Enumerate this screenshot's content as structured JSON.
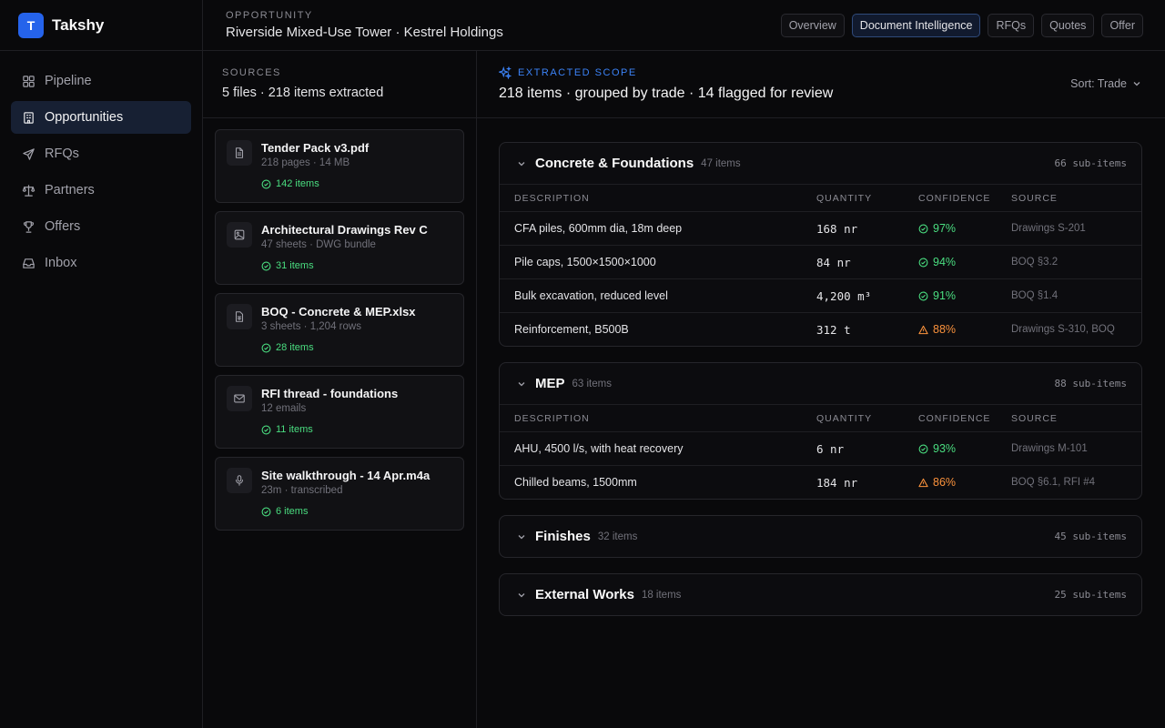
{
  "brand": {
    "logo_letter": "T",
    "name": "Takshy"
  },
  "nav": [
    {
      "label": "Pipeline",
      "icon": "grid-icon",
      "active": false
    },
    {
      "label": "Opportunities",
      "icon": "building-icon",
      "active": true
    },
    {
      "label": "RFQs",
      "icon": "send-icon",
      "active": false
    },
    {
      "label": "Partners",
      "icon": "scale-icon",
      "active": false
    },
    {
      "label": "Offers",
      "icon": "trophy-icon",
      "active": false
    },
    {
      "label": "Inbox",
      "icon": "inbox-icon",
      "active": false
    }
  ],
  "header": {
    "label": "OPPORTUNITY",
    "title": "Riverside Mixed-Use Tower · Kestrel Holdings",
    "tabs": [
      {
        "label": "Overview",
        "active": false
      },
      {
        "label": "Document Intelligence",
        "active": true
      },
      {
        "label": "RFQs",
        "active": false
      },
      {
        "label": "Quotes",
        "active": false
      },
      {
        "label": "Offer",
        "active": false
      }
    ]
  },
  "sources": {
    "label": "SOURCES",
    "summary": "5 files · 218 items extracted",
    "files": [
      {
        "name": "Tender Pack v3.pdf",
        "meta": "218 pages · 14 MB",
        "count": "142 items",
        "icon": "document-icon"
      },
      {
        "name": "Architectural Drawings Rev C",
        "meta": "47 sheets · DWG bundle",
        "count": "31 items",
        "icon": "image-icon"
      },
      {
        "name": "BOQ - Concrete & MEP.xlsx",
        "meta": "3 sheets · 1,204 rows",
        "count": "28 items",
        "icon": "spreadsheet-icon"
      },
      {
        "name": "RFI thread - foundations",
        "meta": "12 emails",
        "count": "11 items",
        "icon": "mail-icon"
      },
      {
        "name": "Site walkthrough - 14 Apr.m4a",
        "meta": "23m · transcribed",
        "count": "6 items",
        "icon": "microphone-icon"
      }
    ]
  },
  "main": {
    "label": "EXTRACTED SCOPE",
    "summary": "218 items · grouped by trade · 14 flagged for review",
    "sort_label": "Sort: Trade",
    "columns": [
      "DESCRIPTION",
      "QUANTITY",
      "CONFIDENCE",
      "SOURCE"
    ],
    "groups": [
      {
        "name": "Concrete & Foundations",
        "count": "47 items",
        "sub": "66 sub-items",
        "expanded": true,
        "rows": [
          {
            "description": "CFA piles, 600mm dia, 18m deep",
            "quantity": "168 nr",
            "confidence": "97%",
            "status": "ok",
            "source": "Drawings S-201"
          },
          {
            "description": "Pile caps, 1500×1500×1000",
            "quantity": "84 nr",
            "confidence": "94%",
            "status": "ok",
            "source": "BOQ §3.2"
          },
          {
            "description": "Bulk excavation, reduced level",
            "quantity": "4,200 m³",
            "confidence": "91%",
            "status": "ok",
            "source": "BOQ §1.4"
          },
          {
            "description": "Reinforcement, B500B",
            "quantity": "312 t",
            "confidence": "88%",
            "status": "warn",
            "source": "Drawings S-310, BOQ"
          }
        ]
      },
      {
        "name": "MEP",
        "count": "63 items",
        "sub": "88 sub-items",
        "expanded": true,
        "rows": [
          {
            "description": "AHU, 4500 l/s, with heat recovery",
            "quantity": "6 nr",
            "confidence": "93%",
            "status": "ok",
            "source": "Drawings M-101"
          },
          {
            "description": "Chilled beams, 1500mm",
            "quantity": "184 nr",
            "confidence": "86%",
            "status": "warn",
            "source": "BOQ §6.1, RFI #4"
          }
        ]
      },
      {
        "name": "Finishes",
        "count": "32 items",
        "sub": "45 sub-items",
        "expanded": false,
        "rows": []
      },
      {
        "name": "External Works",
        "count": "18 items",
        "sub": "25 sub-items",
        "expanded": false,
        "rows": []
      }
    ]
  },
  "colors": {
    "accent": "#2563eb",
    "ok": "#4ade80",
    "warn": "#fb923c"
  }
}
